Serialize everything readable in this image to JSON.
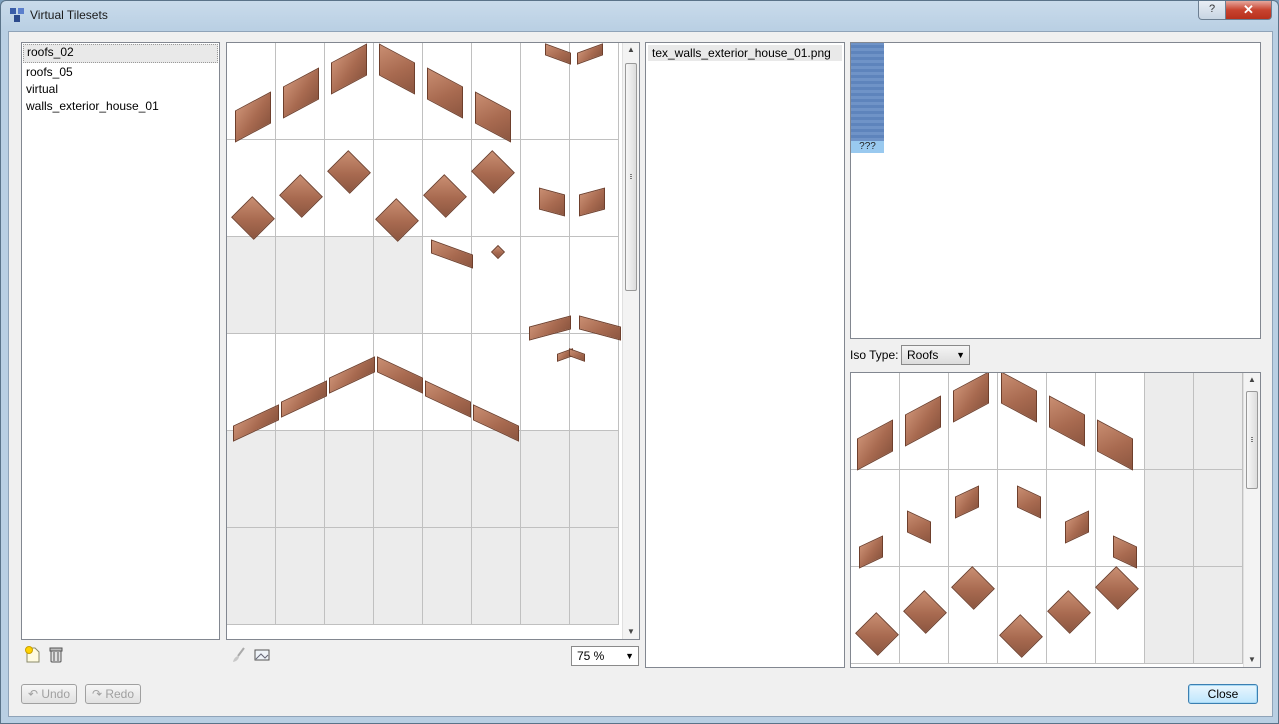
{
  "window": {
    "title": "Virtual Tilesets",
    "help_label": "?",
    "close_glyph": "✕"
  },
  "tilesets": {
    "items": [
      {
        "label": "roofs_02",
        "selected": true
      },
      {
        "label": "roofs_05",
        "selected": false
      },
      {
        "label": "virtual",
        "selected": false
      },
      {
        "label": "walls_exterior_house_01",
        "selected": false
      }
    ]
  },
  "tileset_toolbar": {
    "add_icon": "new-tileset-icon",
    "delete_icon": "trash-icon"
  },
  "editor_toolbar": {
    "clear_icon": "brush-icon",
    "image_icon": "image-icon",
    "zoom_value": "75 %"
  },
  "files": {
    "items": [
      {
        "label": "tex_walls_exterior_house_01.png"
      }
    ]
  },
  "texture": {
    "thumb_label": "???"
  },
  "iso_type": {
    "label": "Iso Type:",
    "value": "Roofs"
  },
  "buttons": {
    "undo": "Undo",
    "redo": "Redo",
    "close": "Close"
  },
  "colors": {
    "tile": "#a86a50",
    "selection": "#99c9ef",
    "default_button_border": "#3c7fb1"
  }
}
